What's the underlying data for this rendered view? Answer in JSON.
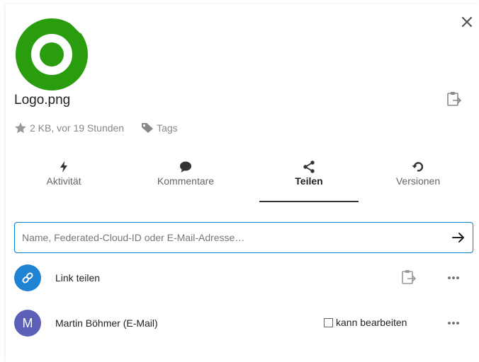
{
  "file": {
    "name": "Logo.png",
    "size_time": "2 KB, vor 19 Stunden",
    "tags_label": "Tags"
  },
  "tabs": [
    {
      "label": "Aktivität",
      "icon": "lightning-icon",
      "active": false
    },
    {
      "label": "Kommentare",
      "icon": "comment-icon",
      "active": false
    },
    {
      "label": "Teilen",
      "icon": "share-icon",
      "active": true
    },
    {
      "label": "Versionen",
      "icon": "history-icon",
      "active": false
    }
  ],
  "search": {
    "placeholder": "Name, Federated-Cloud-ID oder E-Mail-Adresse…",
    "value": ""
  },
  "shares": [
    {
      "avatar_icon": "link-icon",
      "label": "Link teilen",
      "avatar_color": "#1f82d3"
    },
    {
      "avatar_text": "M",
      "label": "Martin Böhmer (E-Mail)",
      "avatar_color": "#5b5fb5",
      "permission_label": "kann bearbeiten",
      "permission_checked": false
    }
  ],
  "colors": {
    "accent": "#0082c9",
    "logo_green": "#2a9d0e"
  }
}
